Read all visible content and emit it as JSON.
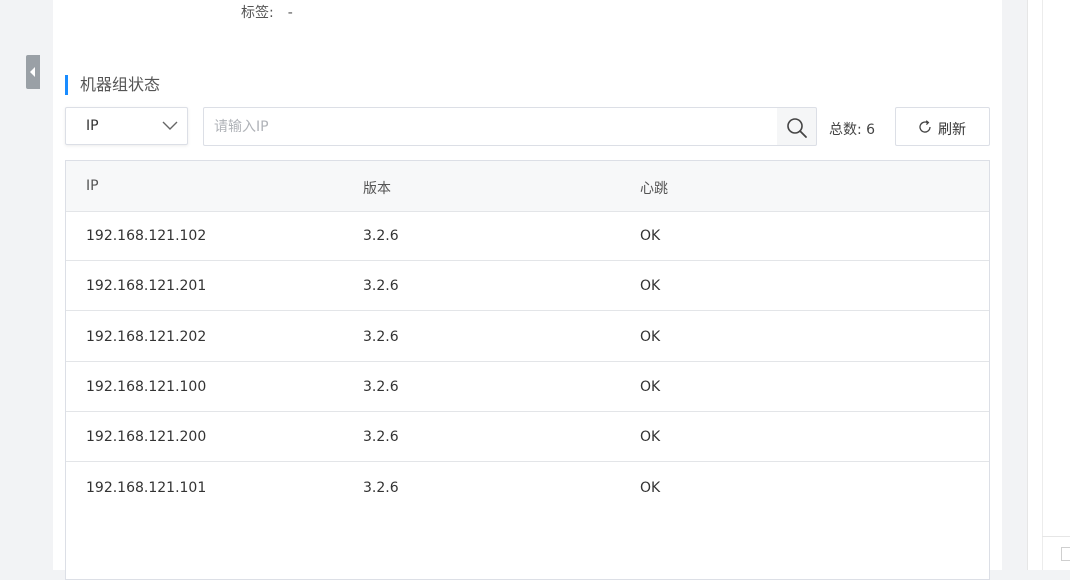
{
  "info": {
    "tag_label": "标签:",
    "tag_value": "-"
  },
  "section": {
    "title": "机器组状态"
  },
  "filter": {
    "select_value": "IP",
    "search_placeholder": "请输入IP",
    "total_label": "总数:",
    "total_count": "6",
    "refresh_label": "刷新"
  },
  "table": {
    "headers": [
      "IP",
      "版本",
      "心跳"
    ],
    "rows": [
      [
        "192.168.121.102",
        "3.2.6",
        "OK"
      ],
      [
        "192.168.121.201",
        "3.2.6",
        "OK"
      ],
      [
        "192.168.121.202",
        "3.2.6",
        "OK"
      ],
      [
        "192.168.121.100",
        "3.2.6",
        "OK"
      ],
      [
        "192.168.121.200",
        "3.2.6",
        "OK"
      ],
      [
        "192.168.121.101",
        "3.2.6",
        "OK"
      ]
    ]
  },
  "colors": {
    "accent": "#1a8cff",
    "border": "#dcdfe6",
    "header_bg": "#f7f8f9"
  },
  "icons": {
    "collapse": "caret-left-icon",
    "select": "chevron-down-icon",
    "search": "search-icon",
    "refresh": "refresh-icon"
  }
}
